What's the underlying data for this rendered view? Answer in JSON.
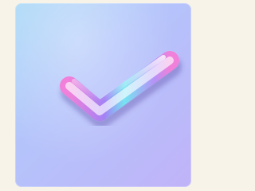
{
  "app": {
    "icon": "checkmark-icon",
    "accent_colors": {
      "background": "#f7f3e8",
      "card_top": "#a9d9f7",
      "card_bottom": "#c0b3f8",
      "check_cyan": "#6fe3f2",
      "check_pink": "#f07ad8",
      "check_violet": "#8a6cf0"
    }
  }
}
